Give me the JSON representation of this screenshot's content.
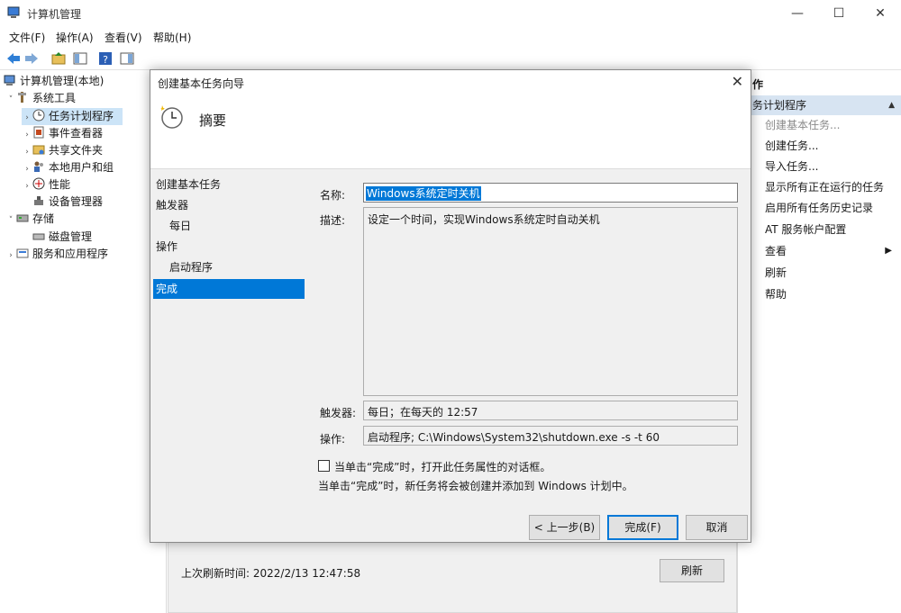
{
  "window": {
    "title": "计算机管理",
    "controls": {
      "minimize": "—",
      "maximize": "☐",
      "close": "✕"
    }
  },
  "menu": [
    "文件(F)",
    "操作(A)",
    "查看(V)",
    "帮助(H)"
  ],
  "tree": [
    {
      "label": "计算机管理(本地)",
      "icon": "computer-icon",
      "chev": ""
    },
    {
      "label": "系统工具",
      "icon": "tools-icon",
      "chev": "˅"
    },
    {
      "label": "任务计划程序",
      "icon": "clock-icon",
      "chev": "›",
      "selected": true
    },
    {
      "label": "事件查看器",
      "icon": "event-viewer-icon",
      "chev": "›"
    },
    {
      "label": "共享文件夹",
      "icon": "shared-folder-icon",
      "chev": "›"
    },
    {
      "label": "本地用户和组",
      "icon": "users-icon",
      "chev": "›"
    },
    {
      "label": "性能",
      "icon": "performance-icon",
      "chev": "›"
    },
    {
      "label": "设备管理器",
      "icon": "device-manager-icon",
      "chev": ""
    },
    {
      "label": "存储",
      "icon": "storage-icon",
      "chev": "˅"
    },
    {
      "label": "磁盘管理",
      "icon": "disk-icon",
      "chev": ""
    },
    {
      "label": "服务和应用程序",
      "icon": "services-icon",
      "chev": "›"
    }
  ],
  "actions": {
    "header": "作",
    "section": "务计划程序",
    "items": [
      {
        "label": "创建基本任务...",
        "disabled": true
      },
      {
        "label": "创建任务..."
      },
      {
        "label": "导入任务..."
      },
      {
        "label": "显示所有正在运行的任务"
      },
      {
        "label": "启用所有任务历史记录"
      },
      {
        "label": "AT 服务帐户配置"
      },
      {
        "label": "查看",
        "submenu": "▶"
      },
      {
        "label": "刷新"
      },
      {
        "label": "帮助"
      }
    ]
  },
  "bottom": {
    "last_refresh": "上次刷新时间: 2022/2/13 12:47:58",
    "refresh_button": "刷新"
  },
  "dialog": {
    "title": "创建基本任务向导",
    "close": "✕",
    "heading": "摘要",
    "steps": [
      {
        "label": "创建基本任务",
        "sub": false
      },
      {
        "label": "触发器",
        "sub": false
      },
      {
        "label": "每日",
        "sub": true
      },
      {
        "label": "操作",
        "sub": false
      },
      {
        "label": "启动程序",
        "sub": true
      },
      {
        "label": "完成",
        "sub": false,
        "current": true
      }
    ],
    "name_label": "名称:",
    "name_value": "Windows系统定时关机",
    "desc_label": "描述:",
    "desc_value": "设定一个时间，实现Windows系统定时自动关机",
    "trigger_label": "触发器:",
    "trigger_value": "每日；在每天的 12:57",
    "action_label": "操作:",
    "action_value": "启动程序; C:\\Windows\\System32\\shutdown.exe -s -t 60",
    "checkbox_label": "当单击“完成”时，打开此任务属性的对话框。",
    "checkbox_checked": false,
    "note": "当单击“完成”时，新任务将会被创建并添加到 Windows 计划中。",
    "buttons": {
      "back": "< 上一步(B)",
      "finish": "完成(F)",
      "cancel": "取消"
    }
  }
}
